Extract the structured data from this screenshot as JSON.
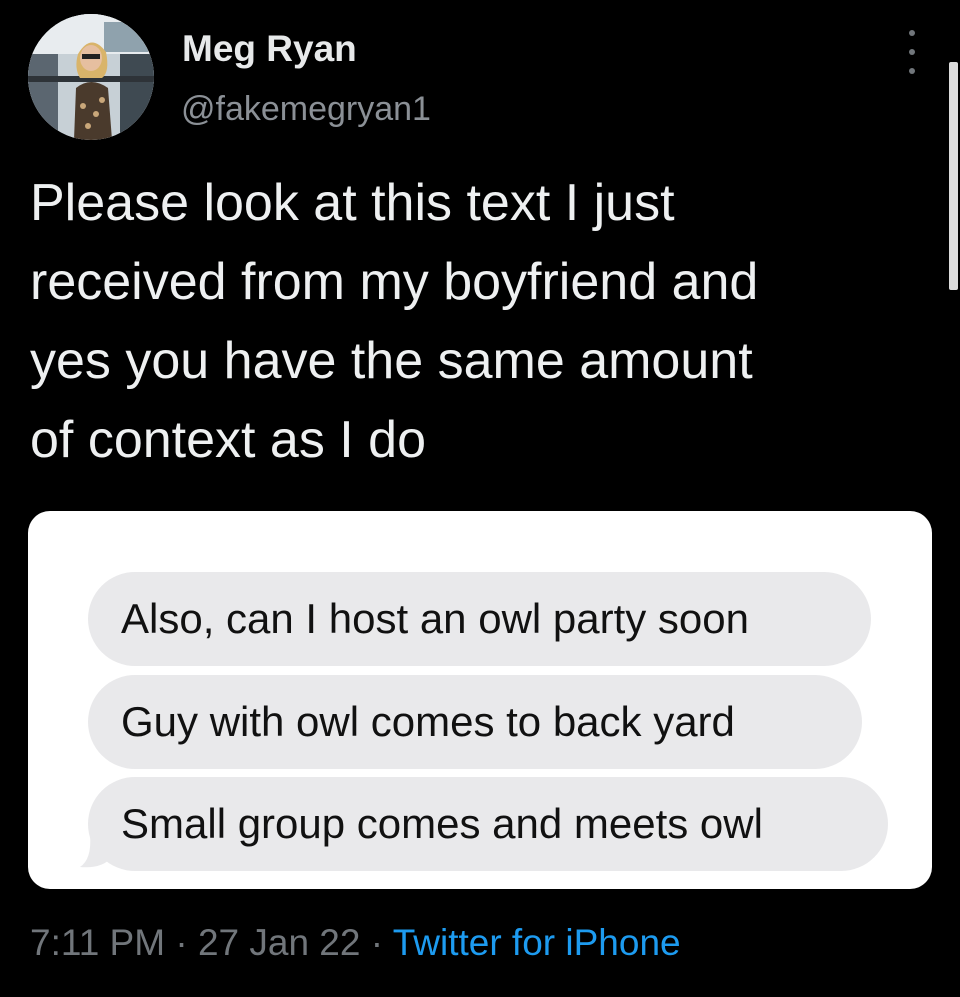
{
  "author": {
    "name": "Meg Ryan",
    "handle": "@fakemegryan1",
    "avatar_icon": "profile-photo"
  },
  "more_icon": "more-vertical-icon",
  "tweet": {
    "text_lines": [
      "Please look at this text I just",
      "received from my boyfriend and",
      "yes you have the same amount",
      "of context as I do"
    ]
  },
  "media": {
    "messages": [
      "Also, can I host an owl party soon",
      "Guy with owl comes to back yard",
      "Small group comes and meets owl"
    ],
    "bubble_color": "#e9e9eb"
  },
  "meta": {
    "time": "7:11 PM",
    "separator": " · ",
    "date": "27 Jan 22",
    "source": "Twitter for iPhone"
  },
  "colors": {
    "background": "#000000",
    "text": "#e7e9ea",
    "secondary": "#71767b",
    "link": "#1d9bf0"
  }
}
